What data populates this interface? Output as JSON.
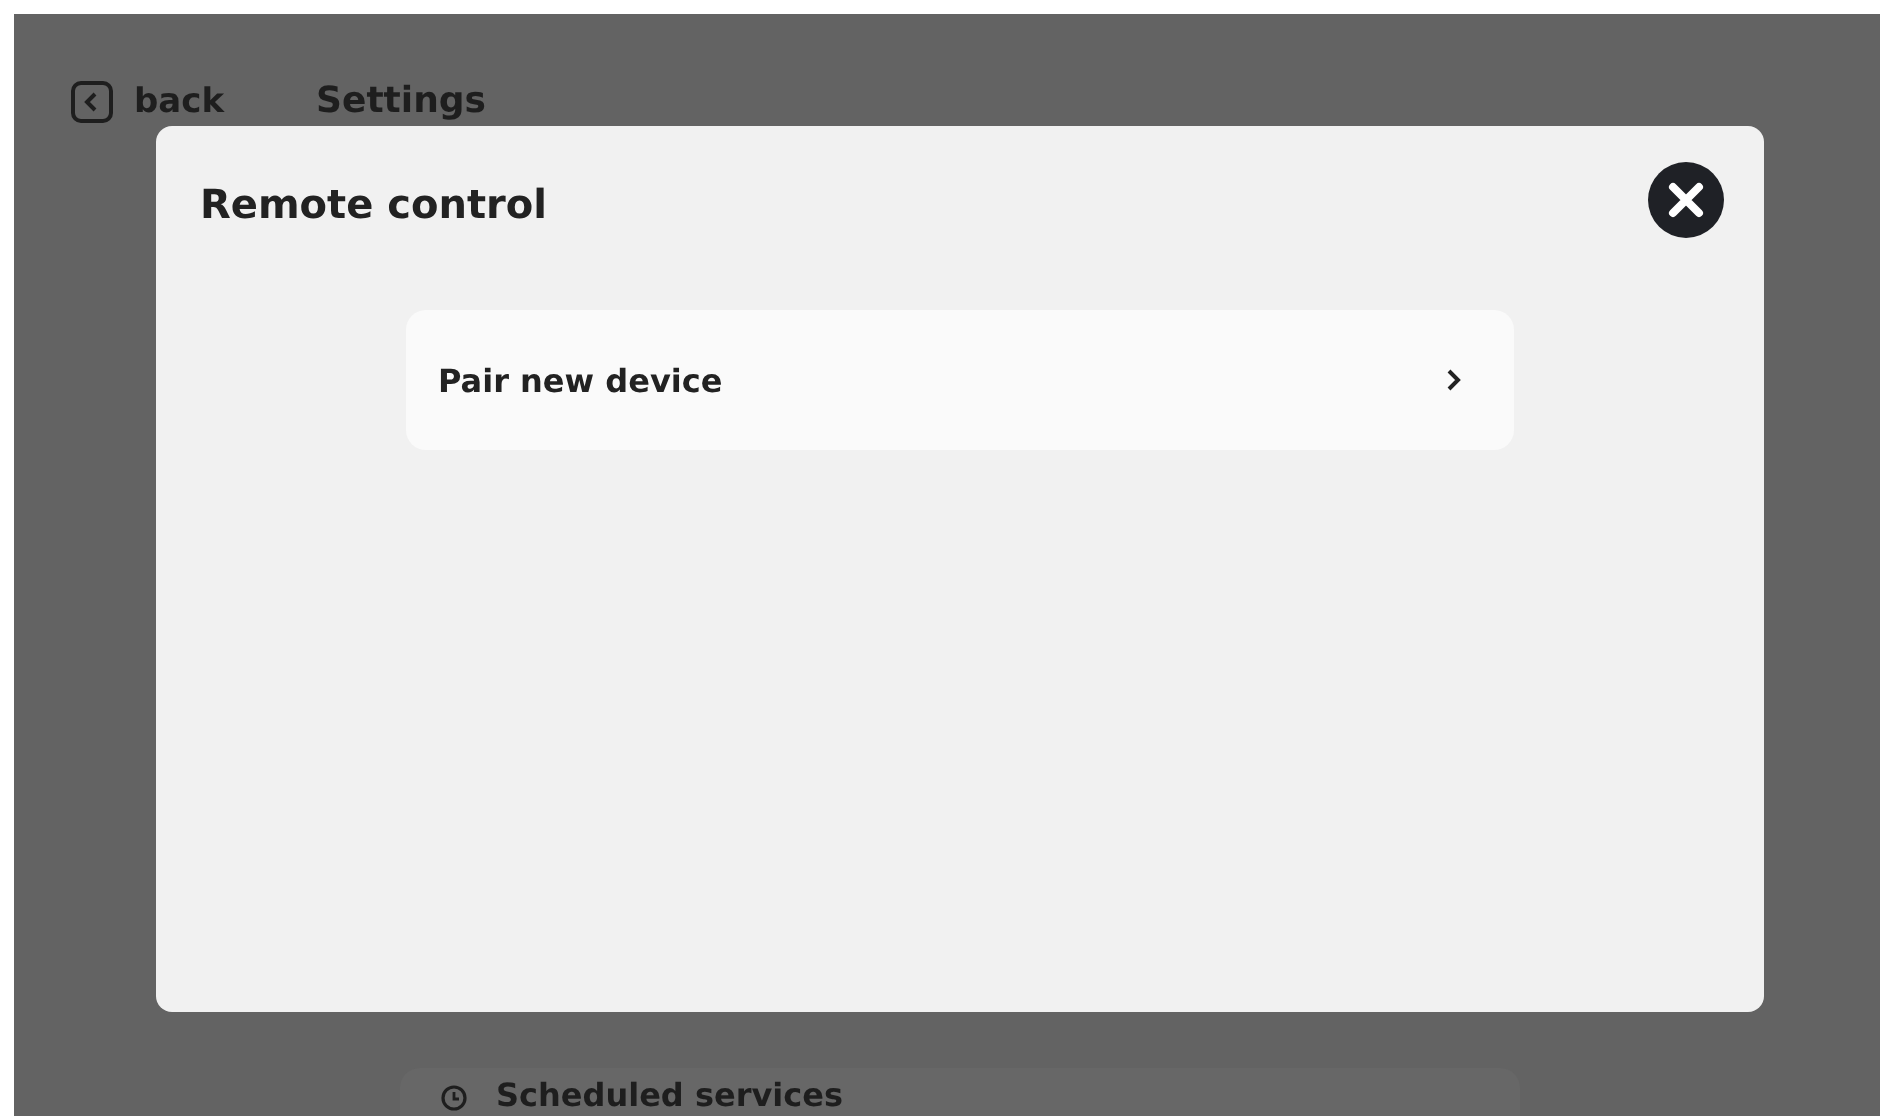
{
  "header": {
    "back_label": "back",
    "title": "Settings"
  },
  "background_items": [
    {
      "label": "Scheduled services"
    }
  ],
  "dialog": {
    "title": "Remote control",
    "items": [
      {
        "label": "Pair new device"
      }
    ]
  }
}
